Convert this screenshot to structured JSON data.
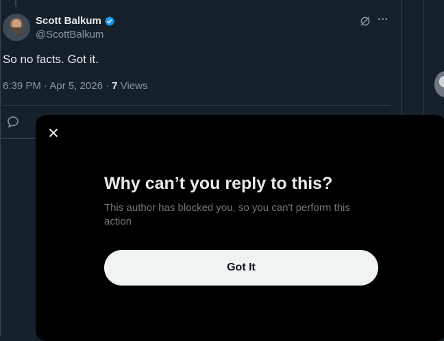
{
  "tweet": {
    "author_name": "Scott Balkum",
    "handle": "@ScottBalkum",
    "text": "So no facts. Got it.",
    "timestamp": "6:39 PM · Apr 5, 2026 · ",
    "views_count": "7",
    "views_label": " Views",
    "more_label": "···"
  },
  "modal": {
    "title": "Why can’t you reply to this?",
    "body": "This author has blocked you, so you can't perform this action",
    "button_label": "Got It"
  },
  "colors": {
    "background": "#15202b",
    "modal_background": "#000000",
    "verified": "#1d9bf0",
    "button_background": "#eff3f4"
  }
}
